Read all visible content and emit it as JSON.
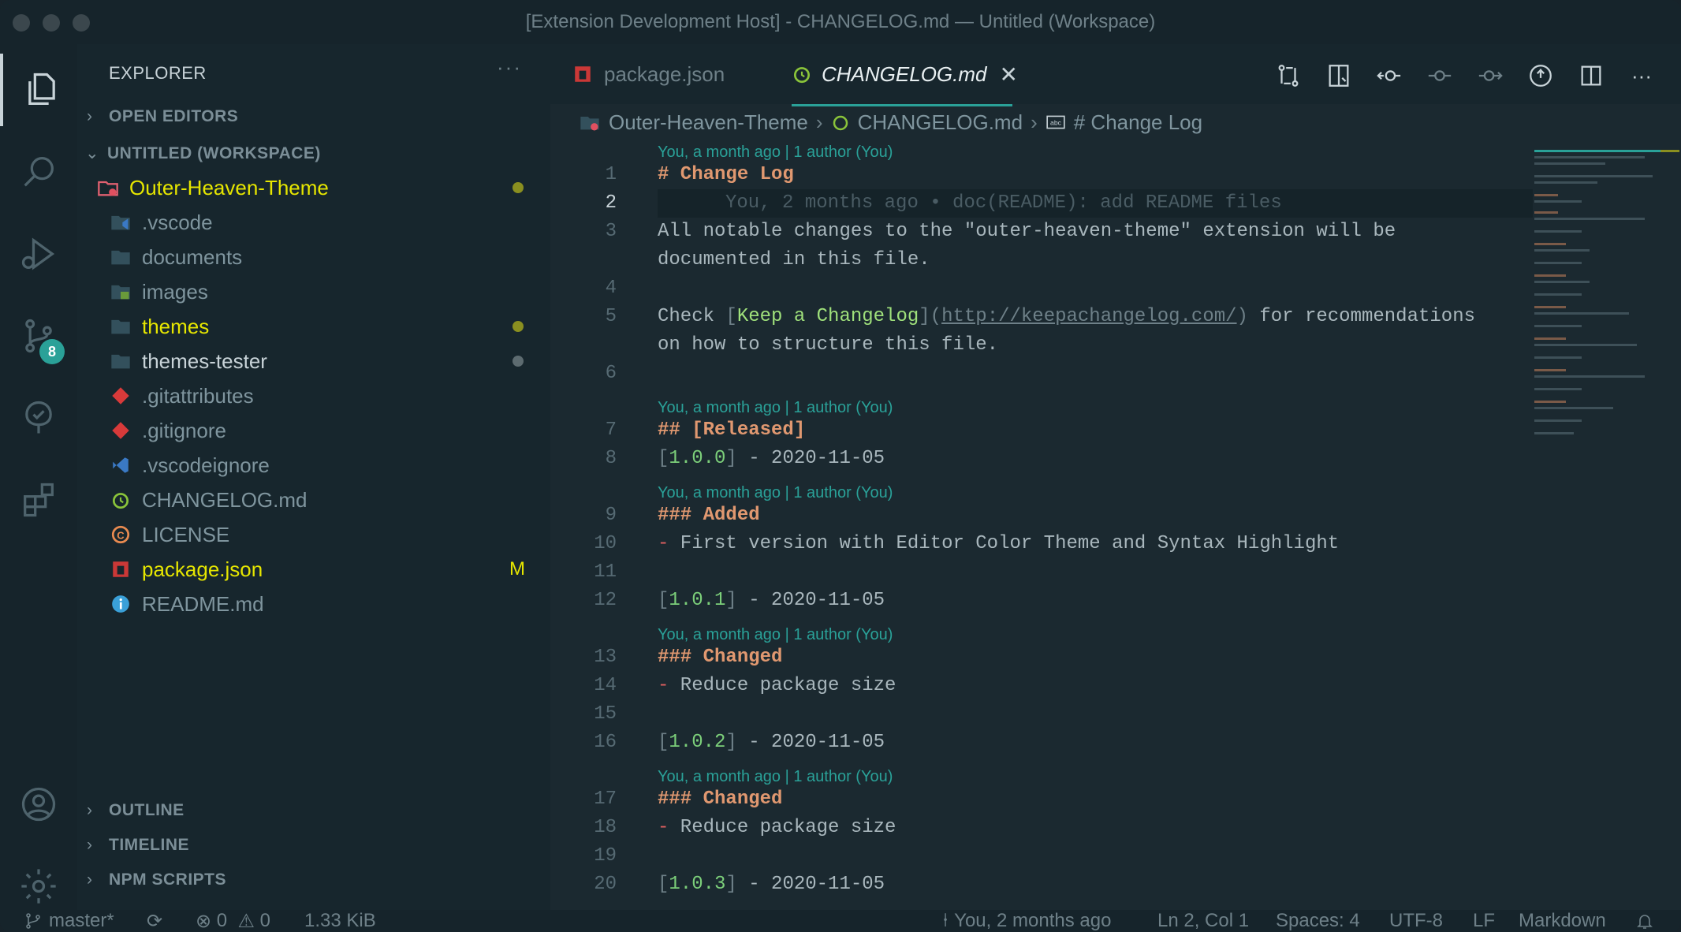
{
  "window": {
    "title": "[Extension Development Host] - CHANGELOG.md — Untitled (Workspace)"
  },
  "activity": {
    "scm_badge": "8"
  },
  "sidebar": {
    "title": "EXPLORER",
    "more": "···",
    "sections": {
      "open_editors": "OPEN EDITORS",
      "workspace": "UNTITLED (WORKSPACE)",
      "outline": "OUTLINE",
      "timeline": "TIMELINE",
      "npm": "NPM SCRIPTS"
    },
    "root": "Outer-Heaven-Theme",
    "files": [
      {
        "name": ".vscode",
        "icon": "folder-vscode-icon"
      },
      {
        "name": "documents",
        "icon": "folder-icon"
      },
      {
        "name": "images",
        "icon": "folder-images-icon"
      },
      {
        "name": "themes",
        "icon": "folder-icon"
      },
      {
        "name": "themes-tester",
        "icon": "folder-icon"
      },
      {
        "name": ".gitattributes",
        "icon": "git-icon"
      },
      {
        "name": ".gitignore",
        "icon": "git-icon"
      },
      {
        "name": ".vscodeignore",
        "icon": "vscode-icon"
      },
      {
        "name": "CHANGELOG.md",
        "icon": "changelog-icon"
      },
      {
        "name": "LICENSE",
        "icon": "license-icon"
      },
      {
        "name": "package.json",
        "icon": "npm-icon"
      },
      {
        "name": "README.md",
        "icon": "info-icon"
      }
    ],
    "modified_letter": "M"
  },
  "tabs": [
    {
      "label": "package.json",
      "active": false
    },
    {
      "label": "CHANGELOG.md",
      "active": true
    }
  ],
  "breadcrumb": {
    "folder": "Outer-Heaven-Theme",
    "file": "CHANGELOG.md",
    "symbol": "# Change Log"
  },
  "code": {
    "lens": "You, a month ago | 1 author (You)",
    "blame": "You, 2 months ago • doc(README): add README files",
    "line1": "# Change Log",
    "line3a": "All notable changes to the \"outer-heaven-theme\" extension will be",
    "line3b": "documented in this file.",
    "line5_check": "Check ",
    "line5_link": "Keep a Changelog",
    "line5_url": "http://keepachangelog.com/",
    "line5_rest": " for recommendations",
    "line5b": "on how to structure this file.",
    "line7": "## [Released]",
    "line8_ver": "1.0.0",
    "line8_date": " - 2020-11-05",
    "line9": "### Added",
    "line10": " First version with Editor Color Theme and Syntax Highlight",
    "line12_ver": "1.0.1",
    "line12_date": " - 2020-11-05",
    "line13": "### Changed",
    "line14": " Reduce package size",
    "line16_ver": "1.0.2",
    "line16_date": " - 2020-11-05",
    "line17": "### Changed",
    "line18": " Reduce package size",
    "line20_ver": "1.0.3",
    "line20_date": " - 2020-11-05"
  },
  "status": {
    "branch": "master*",
    "errors": "0",
    "warnings": "0",
    "size": "1.33 KiB",
    "blame": "You, 2 months ago",
    "position": "Ln 2, Col 1",
    "spaces": "Spaces: 4",
    "encoding": "UTF-8",
    "eol": "LF",
    "language": "Markdown"
  },
  "colors": {
    "accent": "#2aa198",
    "modified": "#e6e600",
    "heading": "#e09870"
  }
}
